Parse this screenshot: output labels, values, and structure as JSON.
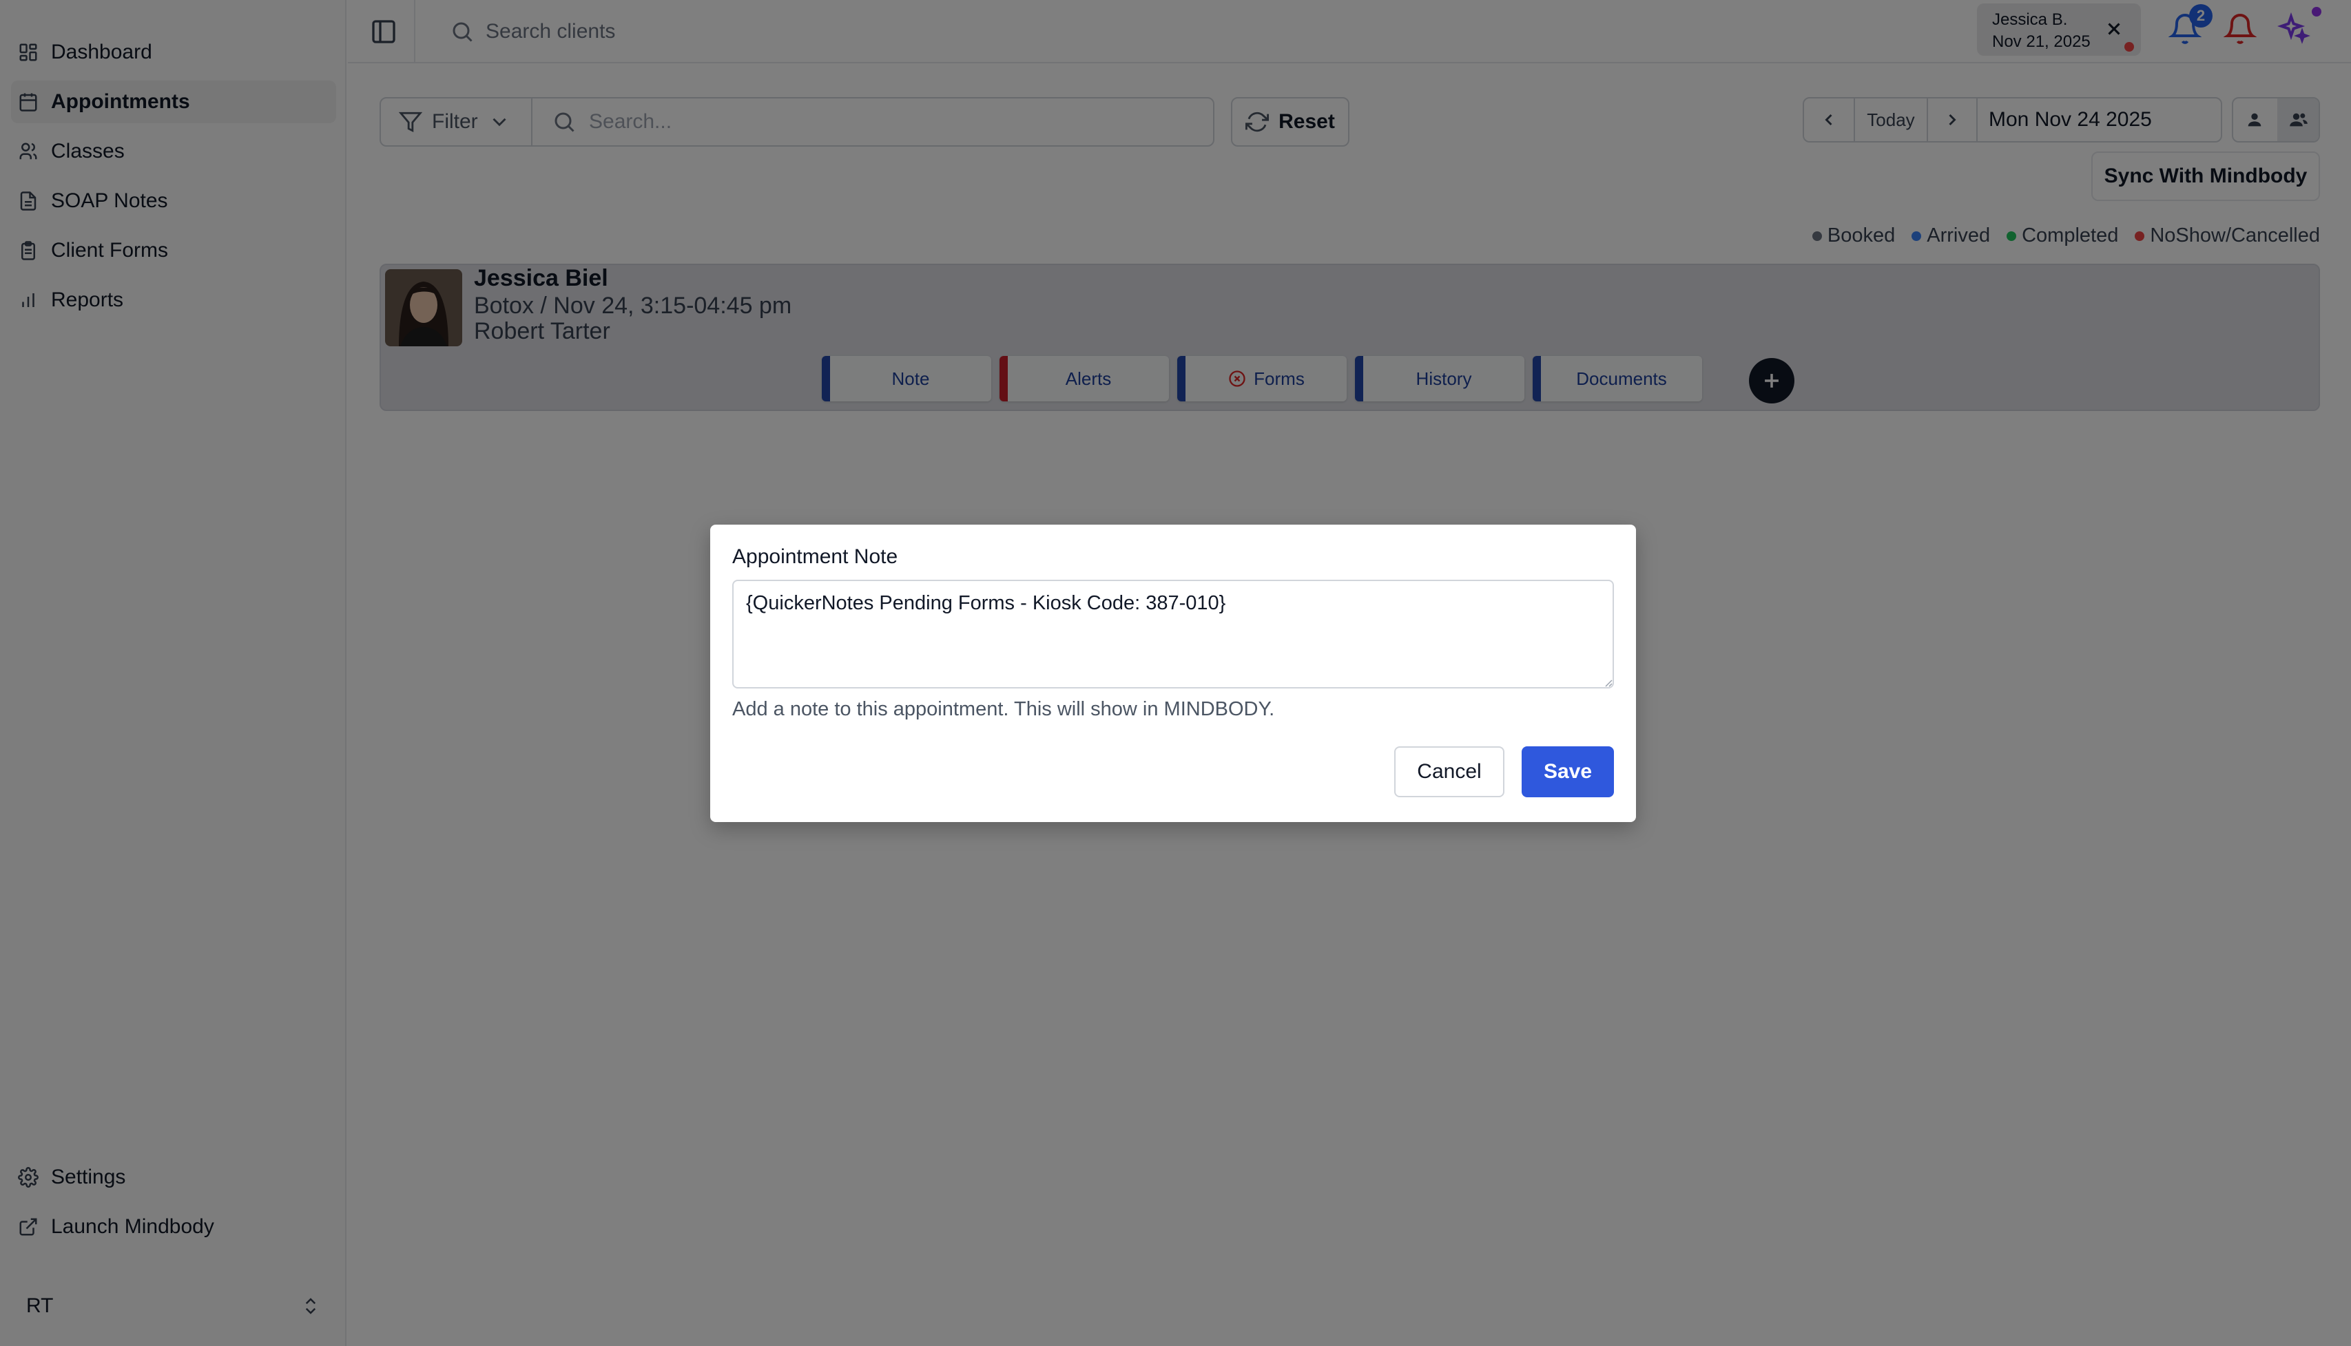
{
  "sidebar": {
    "items": [
      {
        "label": "Dashboard",
        "icon": "dashboard-icon"
      },
      {
        "label": "Appointments",
        "icon": "calendar-icon",
        "active": true
      },
      {
        "label": "Classes",
        "icon": "users-icon"
      },
      {
        "label": "SOAP Notes",
        "icon": "notes-icon"
      },
      {
        "label": "Client Forms",
        "icon": "clipboard-icon"
      },
      {
        "label": "Reports",
        "icon": "bar-chart-icon"
      }
    ],
    "bottom_items": [
      {
        "label": "Settings",
        "icon": "gear-icon"
      },
      {
        "label": "Launch Mindbody",
        "icon": "external-link-icon"
      }
    ],
    "user": {
      "initials": "RT",
      "icon": "chevron-up-down-icon"
    }
  },
  "topbar": {
    "search_placeholder": "Search clients",
    "session_chip": {
      "name": "Jessica B.",
      "date": "Nov 21, 2025"
    },
    "notification_count": "2"
  },
  "toolbar": {
    "filter_label": "Filter",
    "search_placeholder": "Search...",
    "reset_label": "Reset",
    "today_label": "Today",
    "date_value": "Mon Nov 24 2025",
    "sync_label": "Sync With Mindbody"
  },
  "legend": [
    {
      "label": "Booked",
      "color": "#6b7280"
    },
    {
      "label": "Arrived",
      "color": "#3b82f6"
    },
    {
      "label": "Completed",
      "color": "#22c55e"
    },
    {
      "label": "NoShow/Cancelled",
      "color": "#ef4444"
    }
  ],
  "appointment": {
    "client_name": "Jessica Biel",
    "service_time": "Botox / Nov 24, 3:15-04:45 pm",
    "provider": "Robert Tarter",
    "tabs": [
      {
        "label": "Note",
        "accent": "#2347a8"
      },
      {
        "label": "Alerts",
        "accent": "#c81e2a"
      },
      {
        "label": "Forms",
        "accent": "#2347a8",
        "icon": "x-circle-icon",
        "icon_color": "#dc2626"
      },
      {
        "label": "History",
        "accent": "#2347a8"
      },
      {
        "label": "Documents",
        "accent": "#2347a8"
      }
    ]
  },
  "dialog": {
    "title": "Appointment Note",
    "note_value": "{QuickerNotes Pending Forms - Kiosk Code: 387-010}",
    "help_text": "Add a note to this appointment. This will show in MINDBODY.",
    "cancel_label": "Cancel",
    "save_label": "Save"
  },
  "colors": {
    "primary": "#2f58dd",
    "overlay": "rgba(0,0,0,0.5)"
  }
}
